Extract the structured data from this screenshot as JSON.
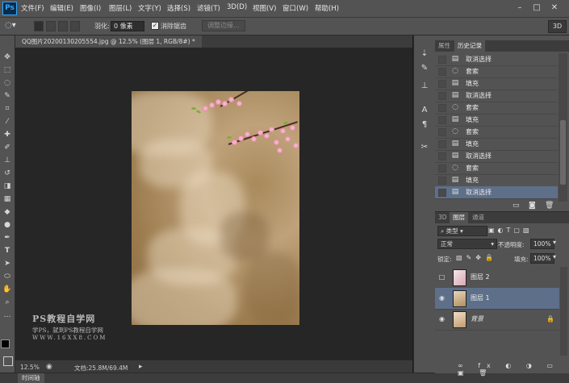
{
  "app": {
    "logo": "Ps"
  },
  "menu": [
    "文件(F)",
    "编辑(E)",
    "图像(I)",
    "图层(L)",
    "文字(Y)",
    "选择(S)",
    "滤镜(T)",
    "3D(D)",
    "视图(V)",
    "窗口(W)",
    "帮助(H)"
  ],
  "options": {
    "feather_label": "羽化:",
    "feather_value": "0 像素",
    "antialias_label": "消除锯齿",
    "refine_edge": "调整边缘...",
    "mode_3d": "3D"
  },
  "document": {
    "tab_title": "QQ图片20200130205554.jpg @ 12.5% (图层 1, RGB/8#) *",
    "watermark_title": "PS教程自学网",
    "watermark_sub": "学PS，就到PS教程自学网",
    "watermark_url": "WWW.16XX8.COM"
  },
  "status": {
    "zoom": "12.5%",
    "doc_info": "文档:25.8M/69.4M"
  },
  "timeline": {
    "label": "时间轴"
  },
  "history": {
    "tabs": [
      "属性",
      "历史记录"
    ],
    "items": [
      {
        "icon": "doc-icon",
        "label": "取消选择"
      },
      {
        "icon": "lasso-icon",
        "label": "套索"
      },
      {
        "icon": "doc-icon",
        "label": "填充"
      },
      {
        "icon": "doc-icon",
        "label": "取消选择"
      },
      {
        "icon": "lasso-icon",
        "label": "套索"
      },
      {
        "icon": "doc-icon",
        "label": "填充"
      },
      {
        "icon": "lasso-icon",
        "label": "套索"
      },
      {
        "icon": "doc-icon",
        "label": "填充"
      },
      {
        "icon": "doc-icon",
        "label": "取消选择"
      },
      {
        "icon": "lasso-icon",
        "label": "套索"
      },
      {
        "icon": "doc-icon",
        "label": "填充"
      },
      {
        "icon": "doc-icon",
        "label": "取消选择"
      }
    ]
  },
  "layers": {
    "tabs": [
      "3D",
      "图层",
      "通道"
    ],
    "filter_kind": "类型",
    "blend_mode": "正常",
    "opacity_label": "不透明度:",
    "opacity_value": "100%",
    "lock_label": "锁定:",
    "fill_label": "填充:",
    "fill_value": "100%",
    "items": [
      {
        "name": "图层 2",
        "visible": false,
        "selected": false,
        "locked": false
      },
      {
        "name": "图层 1",
        "visible": true,
        "selected": true,
        "locked": false
      },
      {
        "name": "背景",
        "visible": true,
        "selected": false,
        "locked": true
      }
    ]
  },
  "colors": {
    "foreground": "#000000",
    "background": "#d4264a",
    "selection": "#5e6f89",
    "panel": "#535353"
  }
}
